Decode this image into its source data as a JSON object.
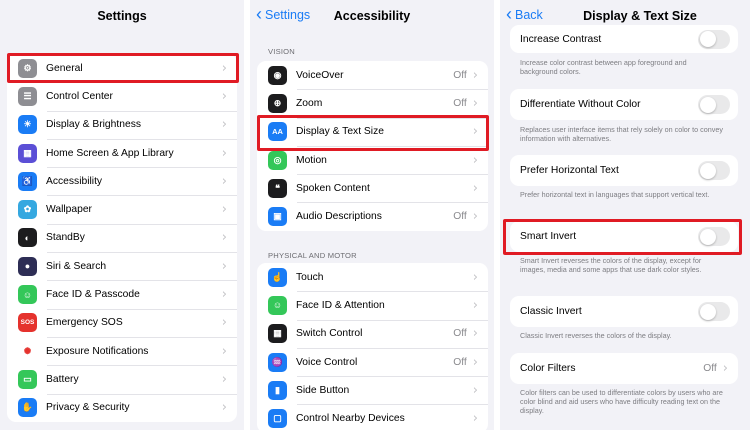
{
  "settings": {
    "title": "Settings",
    "items": [
      {
        "label": "General",
        "icon": "gear-icon",
        "color": "#8e8e93",
        "glyph": "⚙"
      },
      {
        "label": "Control Center",
        "icon": "control-center-icon",
        "color": "#8e8e93",
        "glyph": "☰"
      },
      {
        "label": "Display & Brightness",
        "icon": "brightness-icon",
        "color": "#1a7cf5",
        "glyph": "☀"
      },
      {
        "label": "Home Screen & App Library",
        "icon": "home-screen-icon",
        "color": "#5b4fd6",
        "glyph": "▦"
      },
      {
        "label": "Accessibility",
        "icon": "accessibility-icon",
        "color": "#1a7cf5",
        "glyph": "♿"
      },
      {
        "label": "Wallpaper",
        "icon": "wallpaper-icon",
        "color": "#35a8e0",
        "glyph": "✿"
      },
      {
        "label": "StandBy",
        "icon": "standby-icon",
        "color": "#1c1c1e",
        "glyph": "◐"
      },
      {
        "label": "Siri & Search",
        "icon": "siri-icon",
        "color": "#2d2d55",
        "glyph": "●"
      },
      {
        "label": "Face ID & Passcode",
        "icon": "face-id-icon",
        "color": "#34c759",
        "glyph": "☺"
      },
      {
        "label": "Emergency SOS",
        "icon": "sos-icon",
        "color": "#e5322d",
        "glyph": "SOS"
      },
      {
        "label": "Exposure Notifications",
        "icon": "exposure-icon",
        "color": "#ffffff",
        "glyph": "✺"
      },
      {
        "label": "Battery",
        "icon": "battery-icon",
        "color": "#34c759",
        "glyph": "▭"
      },
      {
        "label": "Privacy & Security",
        "icon": "hand-icon",
        "color": "#1a7cf5",
        "glyph": "✋"
      }
    ]
  },
  "accessibility": {
    "back": "Settings",
    "title": "Accessibility",
    "vision_header": "VISION",
    "vision_items": [
      {
        "label": "VoiceOver",
        "value": "Off",
        "icon": "voiceover-icon",
        "color": "#1c1c1e",
        "glyph": "◉"
      },
      {
        "label": "Zoom",
        "value": "Off",
        "icon": "zoom-icon",
        "color": "#1c1c1e",
        "glyph": "⊕"
      },
      {
        "label": "Display & Text Size",
        "value": "",
        "icon": "text-size-icon",
        "color": "#1a7cf5",
        "glyph": "AA"
      },
      {
        "label": "Motion",
        "value": "",
        "icon": "motion-icon",
        "color": "#34c759",
        "glyph": "◎"
      },
      {
        "label": "Spoken Content",
        "value": "",
        "icon": "spoken-content-icon",
        "color": "#1c1c1e",
        "glyph": "❝"
      },
      {
        "label": "Audio Descriptions",
        "value": "Off",
        "icon": "audio-descriptions-icon",
        "color": "#1a7cf5",
        "glyph": "▣"
      }
    ],
    "motor_header": "PHYSICAL AND MOTOR",
    "motor_items": [
      {
        "label": "Touch",
        "value": "",
        "icon": "touch-icon",
        "color": "#1a7cf5",
        "glyph": "☝"
      },
      {
        "label": "Face ID & Attention",
        "value": "",
        "icon": "face-attention-icon",
        "color": "#34c759",
        "glyph": "☺"
      },
      {
        "label": "Switch Control",
        "value": "Off",
        "icon": "switch-control-icon",
        "color": "#1c1c1e",
        "glyph": "▦"
      },
      {
        "label": "Voice Control",
        "value": "Off",
        "icon": "voice-control-icon",
        "color": "#1a7cf5",
        "glyph": "♒"
      },
      {
        "label": "Side Button",
        "value": "",
        "icon": "side-button-icon",
        "color": "#1a7cf5",
        "glyph": "▮"
      },
      {
        "label": "Control Nearby Devices",
        "value": "",
        "icon": "nearby-devices-icon",
        "color": "#1a7cf5",
        "glyph": "▢"
      }
    ]
  },
  "display": {
    "back": "Back",
    "title": "Display & Text Size",
    "options": [
      {
        "label": "Increase Contrast",
        "desc": "Increase color contrast between app foreground and background colors.",
        "state": "off"
      },
      {
        "label": "Differentiate Without Color",
        "desc": "Replaces user interface items that rely solely on color to convey information with alternatives.",
        "state": "off"
      },
      {
        "label": "Prefer Horizontal Text",
        "desc": "Prefer horizontal text in languages that support vertical text.",
        "state": "off"
      },
      {
        "label": "Smart Invert",
        "desc": "Smart Invert reverses the colors of the display, except for images, media and some apps that use dark color styles.",
        "state": "off"
      },
      {
        "label": "Classic Invert",
        "desc": "Classic Invert reverses the colors of the display.",
        "state": "off"
      },
      {
        "label": "Color Filters",
        "value": "Off",
        "desc": "Color filters can be used to differentiate colors by users who are color blind and aid users who have difficulty reading text on the display."
      }
    ]
  },
  "highlight_color": "#e01b24"
}
